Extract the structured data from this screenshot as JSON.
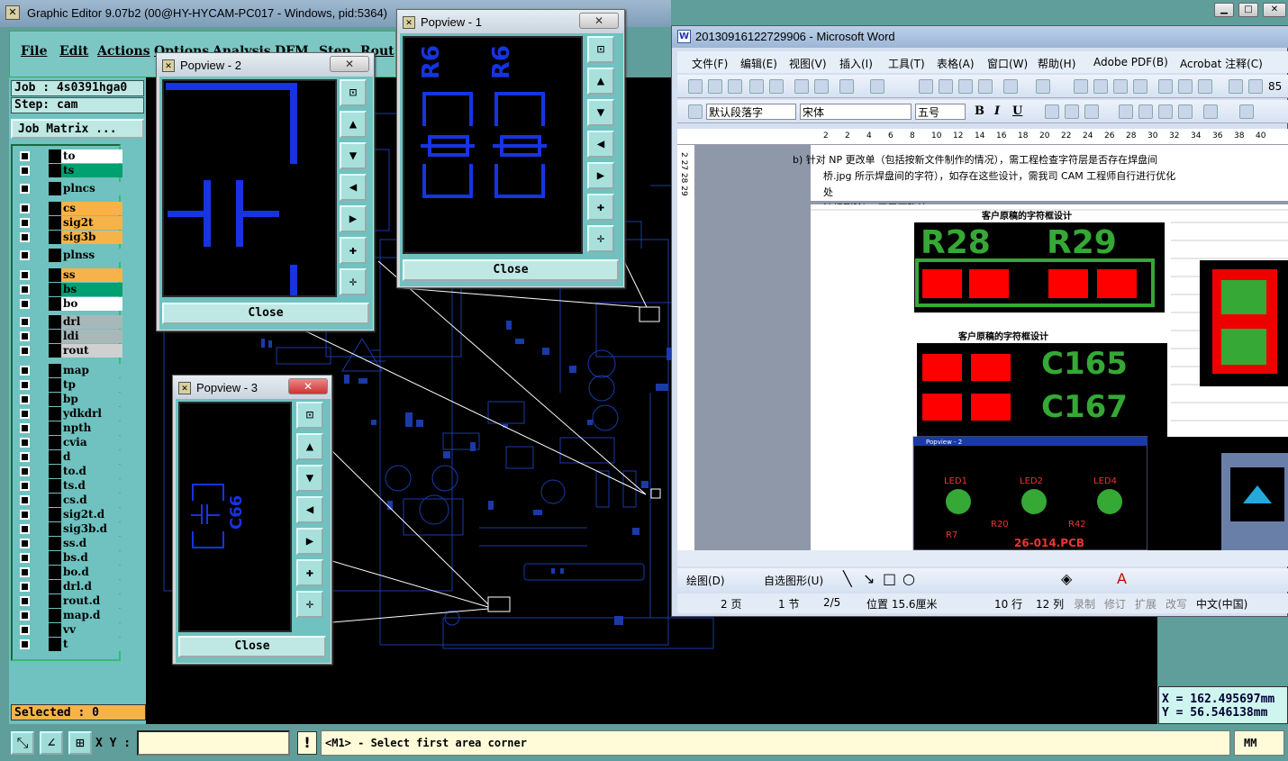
{
  "ge": {
    "title": "Graphic Editor 9.07b2 (00@HY-HYCAM-PC017 - Windows, pid:5364)",
    "menus": [
      "File",
      "Edit",
      "Actions",
      "Options",
      "Analysis",
      "DFM",
      "Step",
      "Rout"
    ],
    "job": "Job : 4s0391hga0",
    "step": "Step: cam",
    "job_matrix": "Job Matrix ...",
    "layers": [
      {
        "name": "to",
        "color": "#ffffff"
      },
      {
        "name": "ts",
        "color": "#00a070"
      },
      {
        "name": "plncs",
        "color": "#6fc2bf"
      },
      {
        "name": "cs",
        "color": "#f5b34a"
      },
      {
        "name": "sig2t",
        "color": "#f5b34a"
      },
      {
        "name": "sig3b",
        "color": "#f5b34a"
      },
      {
        "name": "plnss",
        "color": "#6fc2bf"
      },
      {
        "name": "ss",
        "color": "#f5b34a"
      },
      {
        "name": "bs",
        "color": "#00a070"
      },
      {
        "name": "bo",
        "color": "#ffffff"
      },
      {
        "name": "drl",
        "color": "#a8b8b8"
      },
      {
        "name": "ldi",
        "color": "#a8b8b8"
      },
      {
        "name": "rout",
        "color": "#d0d0d0"
      },
      {
        "name": "map",
        "color": "#6fc2bf"
      },
      {
        "name": "tp",
        "color": "#6fc2bf"
      },
      {
        "name": "bp",
        "color": "#6fc2bf"
      },
      {
        "name": "ydkdrl",
        "color": "#6fc2bf"
      },
      {
        "name": "npth",
        "color": "#6fc2bf"
      },
      {
        "name": "cvia",
        "color": "#6fc2bf"
      },
      {
        "name": "d",
        "color": "#6fc2bf"
      },
      {
        "name": "to.d",
        "color": "#6fc2bf"
      },
      {
        "name": "ts.d",
        "color": "#6fc2bf"
      },
      {
        "name": "cs.d",
        "color": "#6fc2bf"
      },
      {
        "name": "sig2t.d",
        "color": "#6fc2bf"
      },
      {
        "name": "sig3b.d",
        "color": "#6fc2bf"
      },
      {
        "name": "ss.d",
        "color": "#6fc2bf"
      },
      {
        "name": "bs.d",
        "color": "#6fc2bf"
      },
      {
        "name": "bo.d",
        "color": "#6fc2bf"
      },
      {
        "name": "drl.d",
        "color": "#6fc2bf"
      },
      {
        "name": "rout.d",
        "color": "#6fc2bf"
      },
      {
        "name": "map.d",
        "color": "#6fc2bf"
      },
      {
        "name": "vv",
        "color": "#6fc2bf"
      },
      {
        "name": "t",
        "color": "#6fc2bf"
      }
    ],
    "selected": "Selected : 0",
    "xy_label": "X Y :",
    "xy_value": "",
    "message": "<M1> - Select first area corner",
    "units": "MM",
    "coord_x": "X  =  162.495697mm",
    "coord_y": "Y  =  56.546138mm"
  },
  "popview1": {
    "title": "Popview - 1",
    "close": "Close",
    "label": "R6"
  },
  "popview2": {
    "title": "Popview - 2",
    "close": "Close"
  },
  "popview3": {
    "title": "Popview - 3",
    "close": "Close",
    "label": "C66"
  },
  "word": {
    "title": "20130916122729906 - Microsoft Word",
    "menus": [
      "文件(F)",
      "编辑(E)",
      "视图(V)",
      "插入(I)",
      "工具(T)",
      "表格(A)",
      "窗口(W)",
      "帮助(H)",
      "Adobe PDF(B)",
      "Acrobat 注释(C)"
    ],
    "style": "默认段落字",
    "font": "宋体",
    "size": "五号",
    "zoom": "85",
    "para_line1": "b) 针对 NP 更改单（包括按新文件制作的情况），需工程检查字符层是否存在焊盘间",
    "para_line2": "桥.jpg 所示焊盘间的字符），如存在这些设计，需我司 CAM 工程师自行进行优化处",
    "para_line3": "油桥删除），无需再确认：",
    "img_caption1": "客户原稿的字符框设计",
    "img_caption2": "客户原稿的字符框设计",
    "img_r28": "R28",
    "img_r29": "R29",
    "img_c165": "C165",
    "img_c167": "C167",
    "img_pop": "Popview - 2",
    "img_led1": "LED1",
    "img_led2": "LED2",
    "img_led4": "LED4",
    "img_r7": "R7",
    "img_r20": "R20",
    "img_r42": "R42",
    "img_pcb": "26-014.PCB",
    "draw_label": "绘图(D)",
    "autoshape": "自选图形(U)",
    "status": {
      "page": "2 页",
      "section": "1 节",
      "pages": "2/5",
      "pos": "位置 15.6厘米",
      "line": "10 行",
      "col": "12 列",
      "rec": "录制",
      "trk": "修订",
      "ext": "扩展",
      "ovr": "改写",
      "lang": "中文(中国)"
    },
    "ruler": [
      "2",
      "2",
      "4",
      "6",
      "8",
      "10",
      "12",
      "14",
      "16",
      "18",
      "20",
      "22",
      "24",
      "26",
      "28",
      "30",
      "32",
      "34",
      "36",
      "38",
      "40"
    ]
  }
}
